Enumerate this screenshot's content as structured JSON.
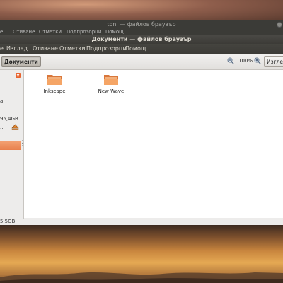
{
  "back_window": {
    "title": "toni — файлов браузър",
    "menu_items": [
      "е",
      "Отиване",
      "Отметки",
      "Подпрозорци",
      "Помощ"
    ]
  },
  "window": {
    "title": "Документи — файлов браузър",
    "menu_items": [
      "е",
      "Изглед",
      "Отиване",
      "Отметки",
      "Подпрозорци",
      "Помощ"
    ]
  },
  "toolbar": {
    "path_button": "Документи",
    "zoom_level": "100%",
    "view_button": "Изгле"
  },
  "sidebar": {
    "entries": [
      "а",
      "95,4GB",
      "..."
    ]
  },
  "files": [
    {
      "name": "Inkscape"
    },
    {
      "name": "New Wave"
    }
  ],
  "status": "5,5GB"
}
